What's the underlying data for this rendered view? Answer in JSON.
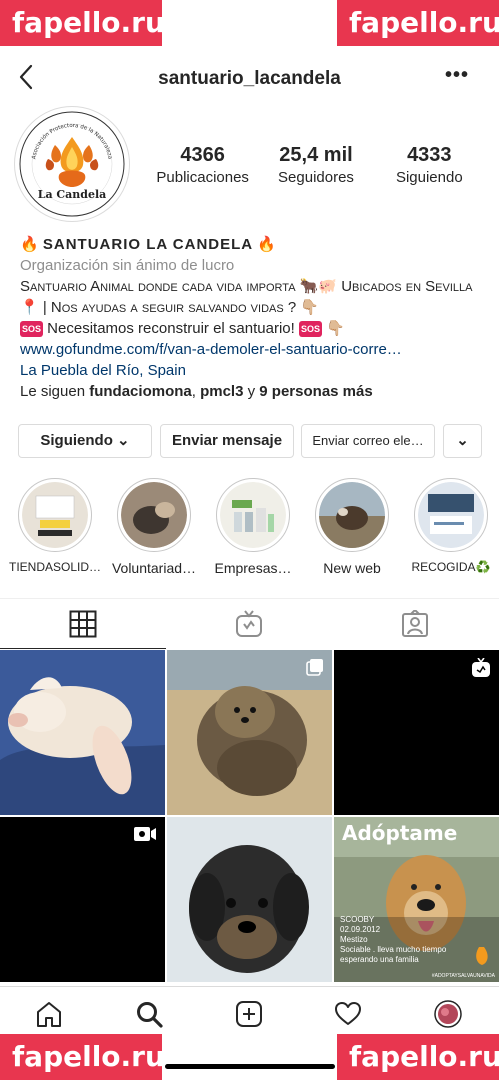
{
  "watermark": "fapello.ru",
  "header": {
    "username": "santuario_lacandela",
    "back_icon": "chevron-left-icon",
    "more_label": "•••"
  },
  "avatar": {
    "logo_name": "La Candela",
    "logo_arc": "Asociación Protectora de la Naturaleza"
  },
  "stats": [
    {
      "value": "4366",
      "label": "Publicaciones"
    },
    {
      "value": "25,4 mil",
      "label": "Seguidores"
    },
    {
      "value": "4333",
      "label": "Siguiendo"
    }
  ],
  "bio": {
    "name_prefix": "🔥",
    "name": "SANTUARIO LA CANDELA",
    "name_suffix": "🔥",
    "category": "Organización sin ánimo de lucro",
    "line1": "Santuario Animal donde cada vida importa 🐂🐖 Ubicados en Sevilla📍 | Nos ayudas a seguir salvando vidas ? 👇🏼",
    "sos_label": "SOS",
    "line2": " Necesitamos reconstruir el santuario! ",
    "line2_end": "👇🏼",
    "link": "www.gofundme.com/f/van-a-demoler-el-santuario-corre…",
    "location": "La Puebla del Río, Spain",
    "followed_prefix": "Le siguen ",
    "followed_a": "fundaciomona",
    "followed_sep": ", ",
    "followed_b": "pmcl3",
    "followed_mid": " y ",
    "followed_c": "9 personas más"
  },
  "buttons": {
    "following": "Siguiendo ⌄",
    "message": "Enviar mensaje",
    "email": "Enviar correo ele…",
    "dropdown": "⌄"
  },
  "highlights": [
    {
      "label": "TIENDASOLID…",
      "color": "#d8cfc4"
    },
    {
      "label": "Voluntariad…",
      "color": "#6a5a4c"
    },
    {
      "label": "Empresas…",
      "color": "#e6e6e0"
    },
    {
      "label": "New web",
      "color": "#7a6a58"
    },
    {
      "label": "RECOGIDA♻️",
      "color": "#b9c3cf"
    }
  ],
  "tabs": [
    "grid-icon",
    "igtv-icon",
    "tagged-icon"
  ],
  "posts": [
    {
      "alt": "lamb",
      "type": "photo"
    },
    {
      "alt": "yorkshire dog",
      "type": "carousel"
    },
    {
      "alt": "black",
      "type": "igtv"
    },
    {
      "alt": "black",
      "type": "video"
    },
    {
      "alt": "black dog",
      "type": "photo"
    },
    {
      "alt": "adoption",
      "type": "photo",
      "title": "Adóptame",
      "name": "SCOOBY",
      "date": "02.09.2012",
      "breed": "Mestizo",
      "desc1": "Sociable . lleva mucho tiempo",
      "desc2": "esperando una familia",
      "tag": "#ADOPTAYSALVAUNAVIDA"
    }
  ],
  "nav": [
    "home-icon",
    "search-icon",
    "add-icon",
    "heart-icon",
    "profile-avatar"
  ]
}
